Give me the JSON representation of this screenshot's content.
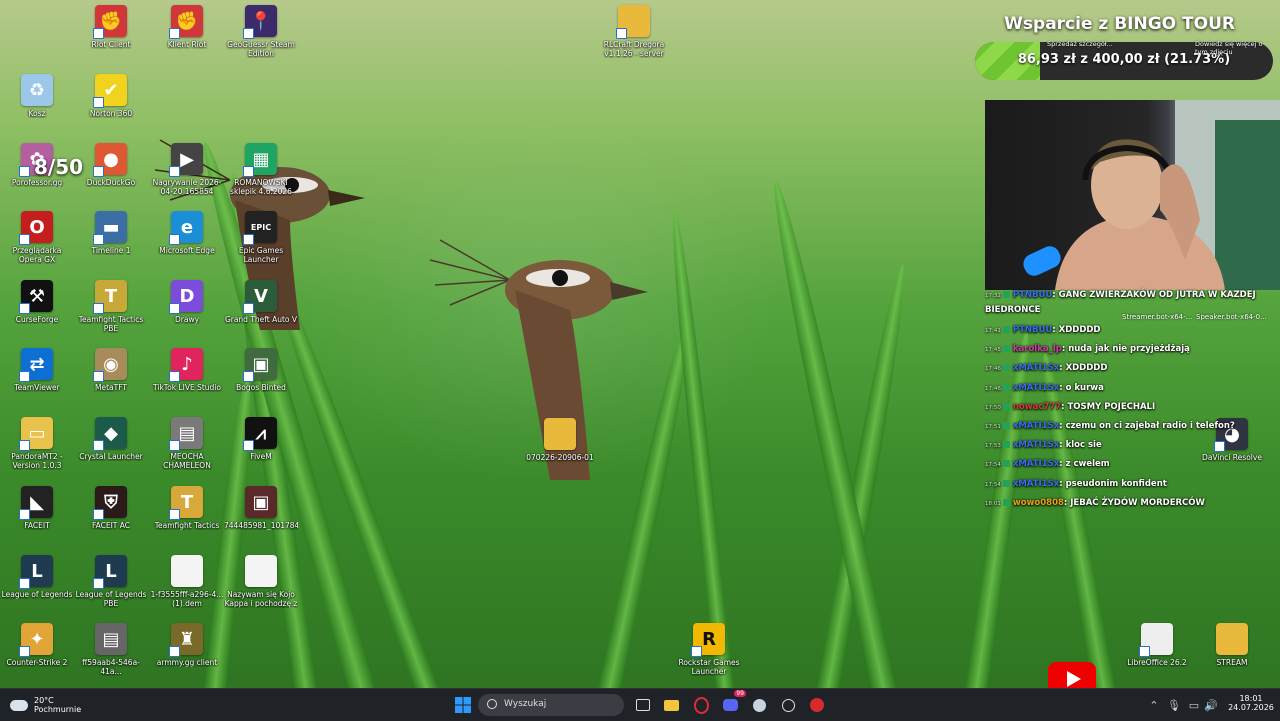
{
  "desktop": {
    "icons": [
      {
        "label": "Riot Client",
        "glyph": "✊",
        "color": "#d13639"
      },
      {
        "label": "Klient Riot",
        "glyph": "✊",
        "color": "#d13639"
      },
      {
        "label": "GeoGuessr Steam Edition",
        "glyph": "📍",
        "color": "#3d2a6b"
      },
      {
        "label": "RLCraft Dregora v1.1.26 - server pack",
        "glyph": "",
        "color": "#e8b93a"
      },
      {
        "label": "Kosz",
        "glyph": "♻",
        "color": "#9bc8e8"
      },
      {
        "label": "Norton 360",
        "glyph": "✔",
        "color": "#f1d31f"
      },
      {
        "label": "Porofessor.gg",
        "glyph": "✿",
        "color": "#b45fa0"
      },
      {
        "label": "DuckDuckGo",
        "glyph": "●",
        "color": "#de5833"
      },
      {
        "label": "Nagrywanie 2026-04-20 165854",
        "glyph": "▶",
        "color": "#444"
      },
      {
        "label": "ROMANOWSKI sklepik 4.6.2026",
        "glyph": "▦",
        "color": "#1fa463"
      },
      {
        "label": "Przeglądarka Opera GX",
        "glyph": "O",
        "color": "#c41e1e"
      },
      {
        "label": "Timeline 1",
        "glyph": "▬",
        "color": "#3a6ea5"
      },
      {
        "label": "Microsoft Edge",
        "glyph": "e",
        "color": "#1a8fd6"
      },
      {
        "label": "Epic Games Launcher",
        "glyph": "EPIC",
        "color": "#222"
      },
      {
        "label": "CurseForge",
        "glyph": "⚒",
        "color": "#111"
      },
      {
        "label": "Teamfight Tactics PBE",
        "glyph": "T",
        "color": "#c8a838"
      },
      {
        "label": "Drawy",
        "glyph": "D",
        "color": "#7c4ddb"
      },
      {
        "label": "Grand Theft Auto V",
        "glyph": "V",
        "color": "#2b5d3a"
      },
      {
        "label": "TeamViewer",
        "glyph": "⇄",
        "color": "#0e6fd3"
      },
      {
        "label": "MetaTFT",
        "glyph": "◉",
        "color": "#a88b5a"
      },
      {
        "label": "TikTok LIVE Studio",
        "glyph": "♪",
        "color": "#e0245e"
      },
      {
        "label": "Bogos Binted",
        "glyph": "▣",
        "color": "#3f6b3f"
      },
      {
        "label": "PandoraMT2 - Version 1.0.3",
        "glyph": "▭",
        "color": "#e8c24a"
      },
      {
        "label": "Crystal Launcher",
        "glyph": "◆",
        "color": "#1c5a4a"
      },
      {
        "label": "MEOCHA CHAMELEON",
        "glyph": "▤",
        "color": "#7a7a7a"
      },
      {
        "label": "FiveM",
        "glyph": "⩘",
        "color": "#111"
      },
      {
        "label": "070226-20906-01",
        "glyph": "",
        "color": "#e8b93a"
      },
      {
        "label": "FACEIT",
        "glyph": "◣",
        "color": "#222"
      },
      {
        "label": "FACEIT AC",
        "glyph": "⛨",
        "color": "#2a1a1a"
      },
      {
        "label": "Teamfight Tactics",
        "glyph": "T",
        "color": "#d9a83a"
      },
      {
        "label": "744485981_101784...",
        "glyph": "▣",
        "color": "#5a2a2a"
      },
      {
        "label": "DaVinci Resolve",
        "glyph": "◕",
        "color": "#2f3440"
      },
      {
        "label": "League of Legends",
        "glyph": "L",
        "color": "#1f3b50"
      },
      {
        "label": "League of Legends PBE",
        "glyph": "L",
        "color": "#1f3b50"
      },
      {
        "label": "1-f3555fff-a296-4... (1).dem",
        "glyph": "",
        "color": "#f4f4f4"
      },
      {
        "label": "Nazywam się Kojo Kappa i pochodzę z",
        "glyph": "",
        "color": "#f4f4f4"
      },
      {
        "label": "Counter-Strike 2",
        "glyph": "✦",
        "color": "#e1a437"
      },
      {
        "label": "ff59aab4-546a-41a...",
        "glyph": "▤",
        "color": "#666"
      },
      {
        "label": "armmy.gg client",
        "glyph": "♜",
        "color": "#7a6a2a"
      },
      {
        "label": "Rockstar Games Launcher",
        "glyph": "R",
        "color": "#f2b800"
      },
      {
        "label": "LibreOffice 26.2",
        "glyph": "",
        "color": "#eee"
      },
      {
        "label": "STREAM",
        "glyph": "",
        "color": "#e8b93a"
      }
    ]
  },
  "overlay": {
    "porofessor_count": "8/50",
    "bingo": {
      "title": "Wsparcie z BINGO TOUR",
      "amount": "86,93 zł z 400,00 zł (21.73%)",
      "progress_fraction": 0.2173,
      "sub_left": "Sprzedaż szczegół...",
      "sub_right": "Dowiedz się więcej o tym zdjęciu"
    },
    "scene_items": [
      "Streamer.bot-x64-...",
      "Speaker.bot-x64-0..."
    ],
    "chat": [
      {
        "time": "17:32",
        "user": "PTNBUU",
        "user_color": "#3a6cf0",
        "msg": "GANG ZWIERZAKÓW OD JUTRA W KAZDEJ BIEDRONCE"
      },
      {
        "time": "17:41",
        "user": "PTNBUU",
        "user_color": "#3a6cf0",
        "msg": "XDDDDD"
      },
      {
        "time": "17:45",
        "user": "karolka_lp",
        "user_color": "#d23aa8",
        "msg": "nuda jak nie przyjeżdżają"
      },
      {
        "time": "17:46",
        "user": "xMATI1Sx",
        "user_color": "#3a6cf0",
        "msg": "XDDDDD"
      },
      {
        "time": "17:46",
        "user": "xMATI1Sx",
        "user_color": "#3a6cf0",
        "msg": "o kurwa"
      },
      {
        "time": "17:50",
        "user": "nowac777",
        "user_color": "#d33c3c",
        "msg": "TOSMY POJECHALI"
      },
      {
        "time": "17:51",
        "user": "xMATI1Sx",
        "user_color": "#3a6cf0",
        "msg": "czemu on ci zajebał radio i telefon?"
      },
      {
        "time": "17:53",
        "user": "xMATI1Sx",
        "user_color": "#3a6cf0",
        "msg": "kloc sie"
      },
      {
        "time": "17:54",
        "user": "xMATI1Sx",
        "user_color": "#3a6cf0",
        "msg": "z cwelem"
      },
      {
        "time": "17:54",
        "user": "xMATI1Sx",
        "user_color": "#3a6cf0",
        "msg": "pseudonim konfident"
      },
      {
        "time": "18:01",
        "user": "wowo0808",
        "user_color": "#e8a020",
        "msg": "JEBAĆ ŻYDÓW MORDERCÓW"
      }
    ]
  },
  "taskbar": {
    "weather_temp": "20°C",
    "weather_desc": "Pochmurnie",
    "search_placeholder": "Wyszukaj",
    "time": "18:01",
    "date": "24.07.2026",
    "mail_badge": "99"
  }
}
